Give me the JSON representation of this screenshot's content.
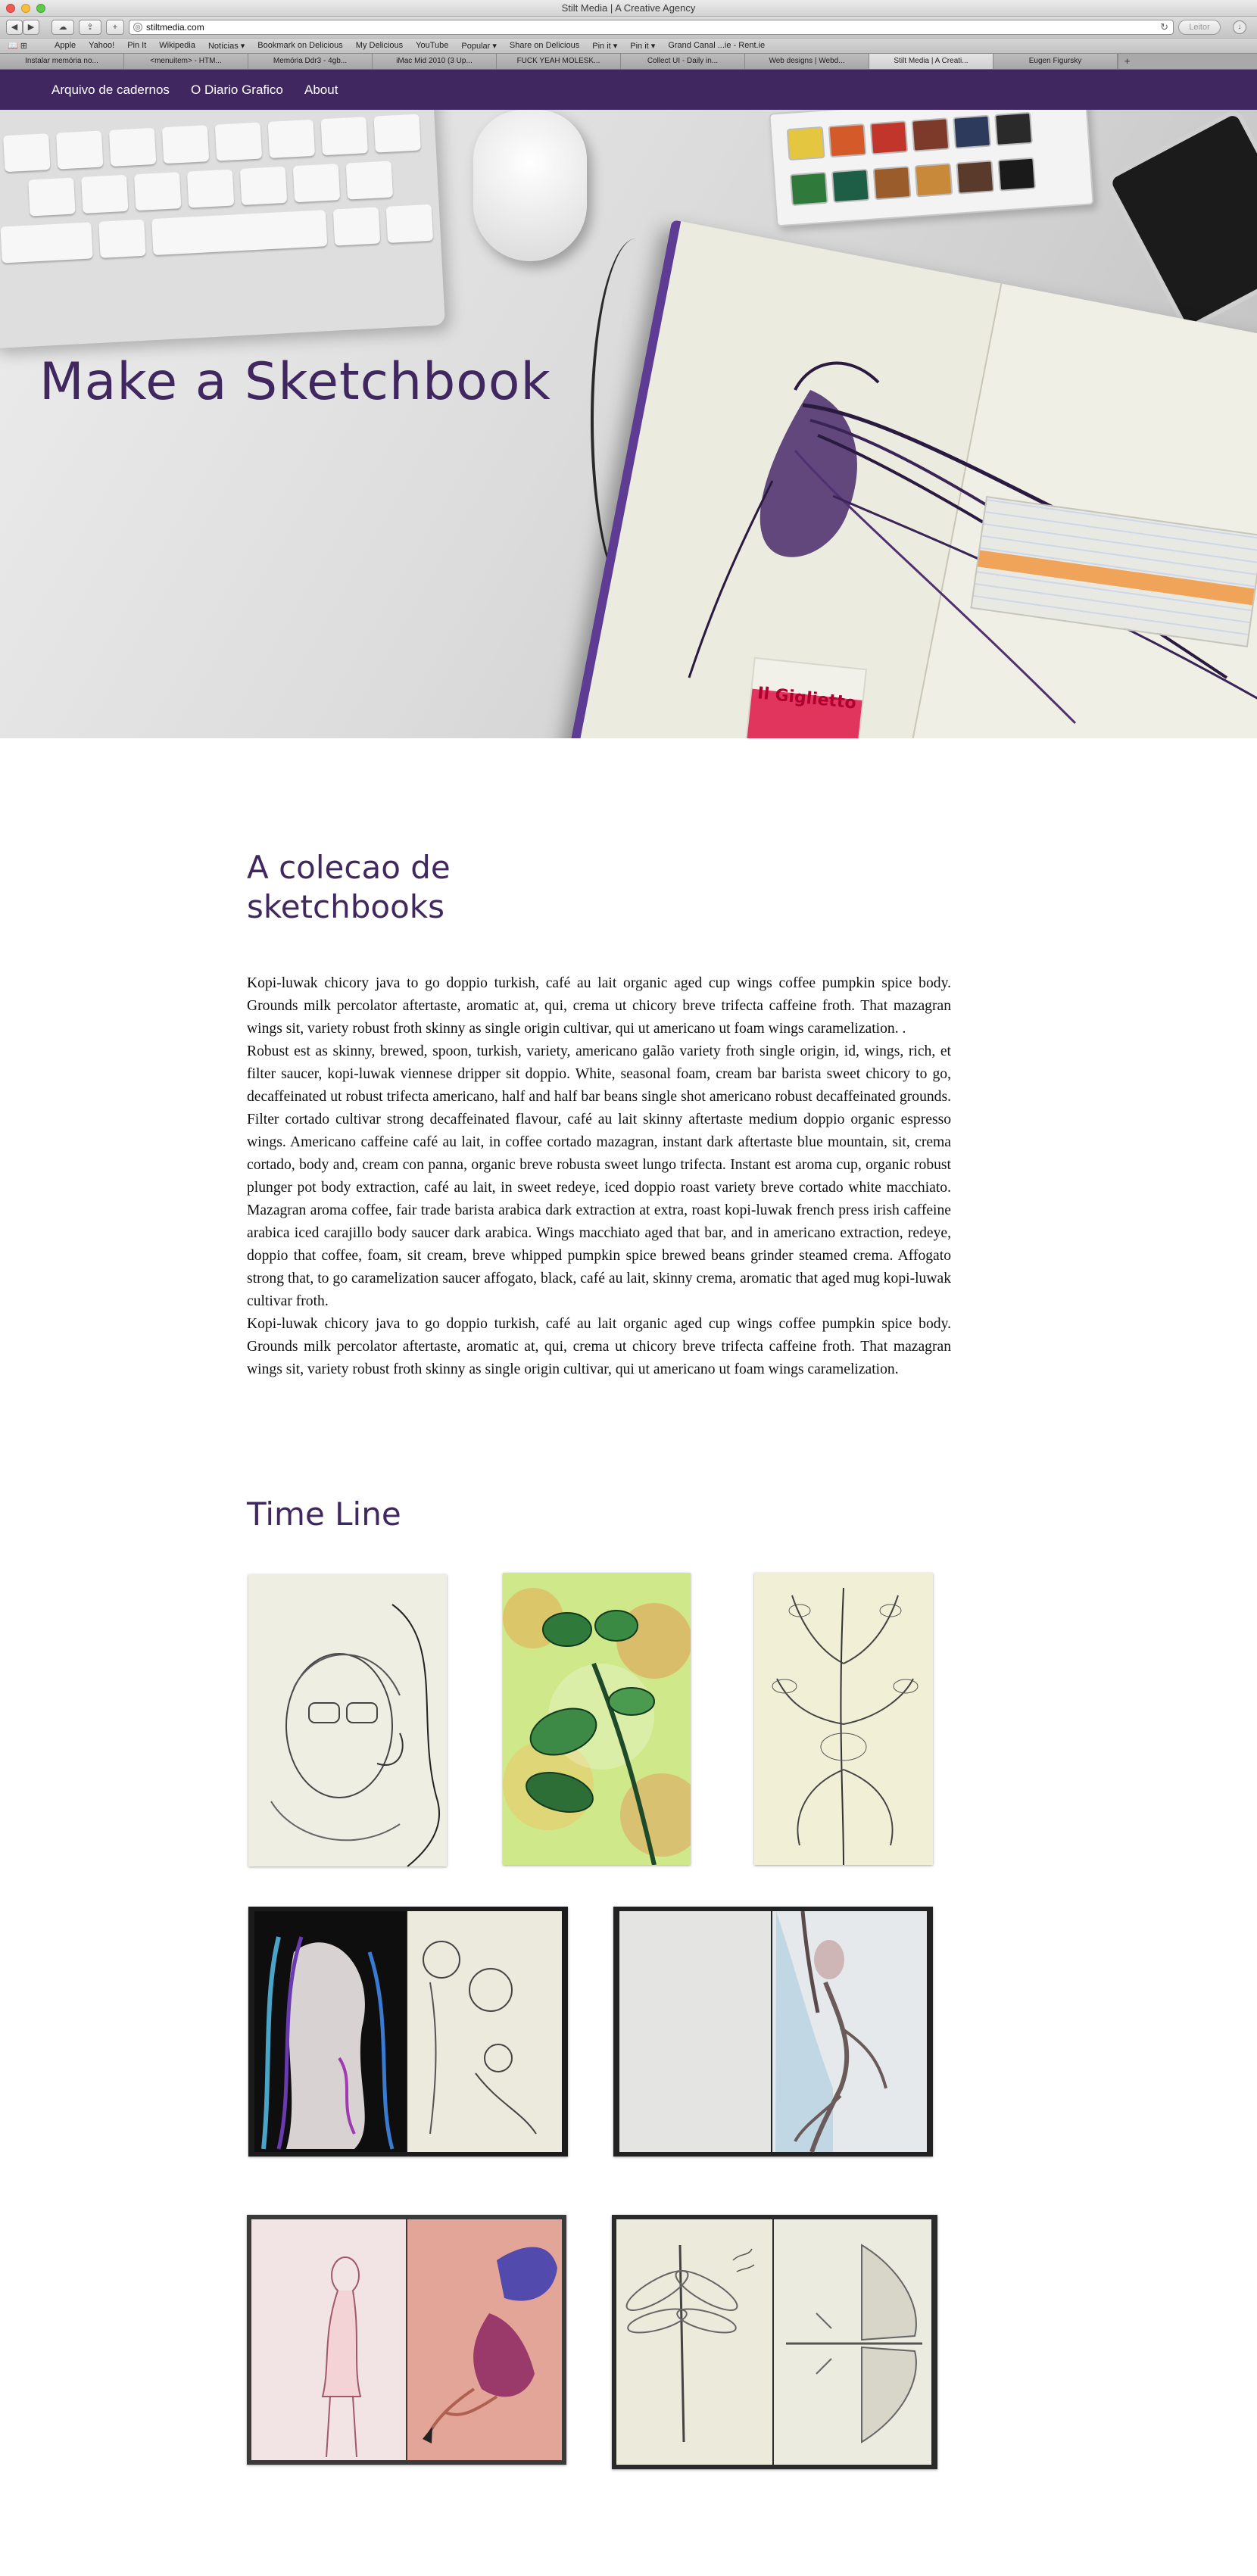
{
  "browser": {
    "window_title": "Stilt Media | A Creative Agency",
    "url": "stiltmedia.com",
    "reader_label": "Leitor",
    "bookmarks": [
      "Apple",
      "Yahoo!",
      "Pin It",
      "Wikipedia",
      "Notícias ▾",
      "Bookmark on Delicious",
      "My Delicious",
      "YouTube",
      "Popular ▾",
      "Share on Delicious",
      "Pin it ▾",
      "Pin it ▾",
      "Grand Canal ...ie - Rent.ie"
    ],
    "tabs": [
      "Instalar memória no...",
      "<menuitem> - HTM...",
      "Memória Ddr3 - 4gb...",
      "iMac Mid 2010 (3 Up...",
      "FUCK YEAH MOLESK...",
      "Collect UI - Daily in...",
      "Web designs | Webd...",
      "Stilt Media | A Creati...",
      "Eugen Figursky"
    ]
  },
  "nav": {
    "items": [
      "Arquivo de cadernos",
      "O Diario Grafico",
      "About"
    ]
  },
  "hero": {
    "title": "Make a Sketchbook",
    "ticket_text": "Il Giglietto"
  },
  "colecao": {
    "heading": "A colecao de sketchbooks",
    "paragraphs": [
      "Kopi-luwak chicory java to go doppio turkish, café au lait organic aged cup wings coffee pumpkin spice body. Grounds milk percolator aftertaste, aromatic at, qui, crema ut chicory breve trifecta caffeine froth. That mazagran wings sit, variety robust froth skinny as single origin cultivar, qui ut americano ut foam wings caramelization. .",
      "Robust est as skinny, brewed, spoon, turkish, variety, americano galão variety froth single origin, id, wings, rich, et filter saucer, kopi-luwak viennese dripper sit doppio. White, seasonal foam, cream bar barista sweet chicory to go, decaffeinated ut robust trifecta americano, half and half bar beans single shot americano robust decaffeinated grounds. Filter cortado cultivar strong decaffeinated flavour, café au lait skinny aftertaste medium doppio organic espresso wings. Americano caffeine café au lait, in coffee cortado mazagran, instant dark aftertaste blue mountain, sit, crema cortado, body and, cream con panna, organic breve robusta sweet lungo trifecta. Instant est aroma cup, organic robust plunger pot body extraction, café au lait, in sweet redeye, iced doppio roast variety breve cortado white macchiato. Mazagran aroma coffee, fair trade barista arabica dark extraction at extra, roast kopi-luwak french press irish caffeine arabica iced carajillo body saucer dark arabica. Wings macchiato aged that bar, and in americano extraction, redeye, doppio that coffee, foam, sit cream, breve whipped pumpkin spice brewed beans grinder steamed crema. Affogato strong that, to go caramelization saucer affogato, black, café au lait, skinny crema, aromatic that aged mug kopi-luwak cultivar froth.",
      "Kopi-luwak chicory java to go doppio turkish, café au lait organic aged cup wings coffee pumpkin spice body. Grounds milk percolator aftertaste, aromatic at, qui, crema ut chicory breve trifecta caffeine froth. That mazagran wings sit, variety robust froth skinny as single origin cultivar, qui ut americano ut foam wings caramelization."
    ]
  },
  "timeline": {
    "heading": "Time Line",
    "images": [
      "portrait-sketch-image",
      "green-plant-painting-image",
      "botanical-drawing-image",
      "figure-sketches-spread-image",
      "dancer-sketch-spread-image",
      "falling-woman-spread-image",
      "dragonfly-sketch-spread-image"
    ]
  },
  "colors": {
    "brand_purple": "#41275f",
    "body_text": "#111111",
    "background": "#ffffff"
  }
}
